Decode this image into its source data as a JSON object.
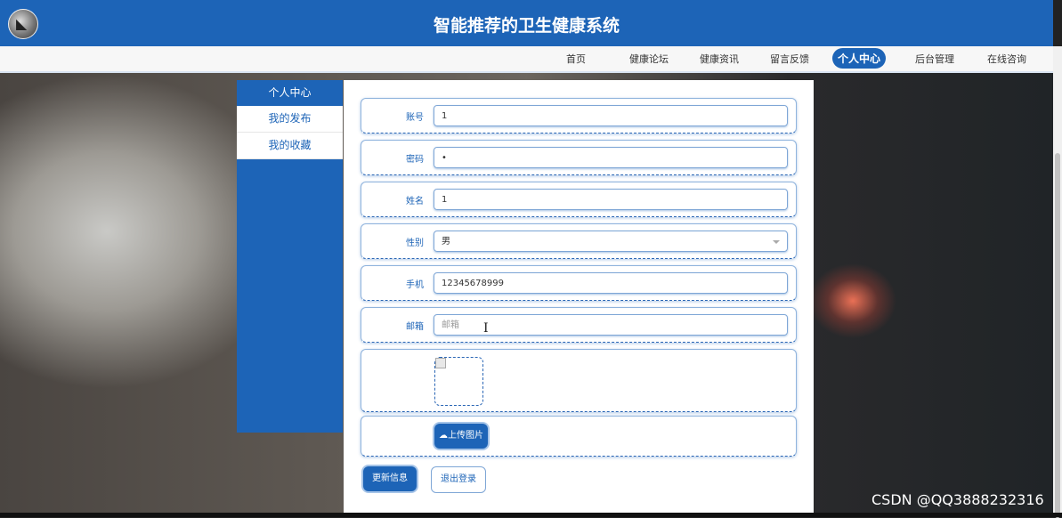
{
  "header": {
    "title": "智能推荐的卫生健康系统"
  },
  "nav": {
    "items": [
      {
        "label": "首页"
      },
      {
        "label": "健康论坛"
      },
      {
        "label": "健康资讯"
      },
      {
        "label": "留言反馈"
      },
      {
        "label": "个人中心",
        "active": true
      },
      {
        "label": "后台管理"
      },
      {
        "label": "在线咨询"
      }
    ]
  },
  "sidebar": {
    "items": [
      {
        "label": "个人中心",
        "active": true
      },
      {
        "label": "我的发布"
      },
      {
        "label": "我的收藏"
      }
    ]
  },
  "form": {
    "account": {
      "label": "账号",
      "value": "1"
    },
    "password": {
      "label": "密码",
      "value": "•"
    },
    "name": {
      "label": "姓名",
      "value": "1"
    },
    "gender": {
      "label": "性别",
      "value": "男"
    },
    "phone": {
      "label": "手机",
      "value": "12345678999"
    },
    "email": {
      "label": "邮箱",
      "placeholder": "邮箱"
    },
    "upload_label": "上传图片",
    "update_label": "更新信息",
    "logout_label": "退出登录"
  },
  "watermark": "CSDN @QQ3888232316",
  "colors": {
    "primary": "#1d64b7"
  }
}
